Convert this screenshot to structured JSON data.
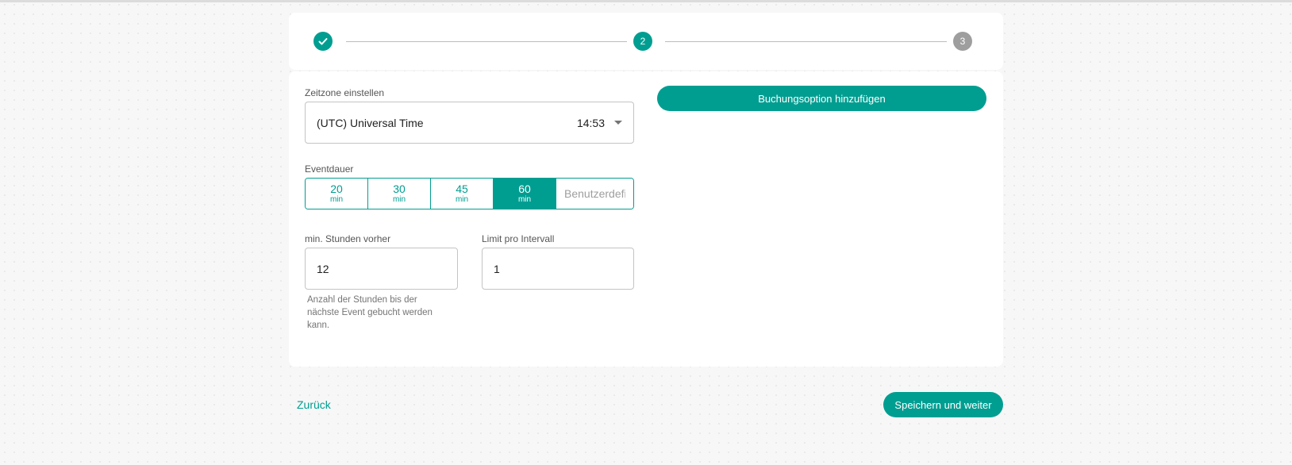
{
  "stepper": {
    "steps": [
      {
        "label": "",
        "state": "done",
        "icon": "check-icon"
      },
      {
        "label": "2",
        "state": "active"
      },
      {
        "label": "3",
        "state": "pending"
      }
    ]
  },
  "timezone": {
    "label": "Zeitzone einstellen",
    "value": "(UTC) Universal Time",
    "time": "14:53"
  },
  "duration": {
    "label": "Eventdauer",
    "options": [
      {
        "value": "20",
        "unit": "min",
        "selected": false
      },
      {
        "value": "30",
        "unit": "min",
        "selected": false
      },
      {
        "value": "45",
        "unit": "min",
        "selected": false
      },
      {
        "value": "60",
        "unit": "min",
        "selected": true
      }
    ],
    "custom_placeholder": "Benutzerdefiniert"
  },
  "min_hours": {
    "label": "min. Stunden vorher",
    "value": "12",
    "hint": "Anzahl der Stunden bis der nächste Event gebucht werden kann."
  },
  "limit": {
    "label": "Limit pro Intervall",
    "value": "1"
  },
  "add_option_label": "Buchungsoption hinzufügen",
  "footer": {
    "back_label": "Zurück",
    "save_label": "Speichern und weiter"
  },
  "colors": {
    "accent": "#009e91",
    "pending": "#9e9e9e"
  }
}
